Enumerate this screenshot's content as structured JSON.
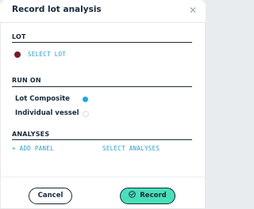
{
  "modal": {
    "title": "Record lot analysis",
    "close_icon": "close-icon"
  },
  "lot": {
    "section_label": "LOT",
    "select_label": "SELECT LOT",
    "dot_color": "#7a1a2c"
  },
  "run_on": {
    "section_label": "RUN ON",
    "options": [
      {
        "label": "Lot Composite",
        "selected": true
      },
      {
        "label": "Individual vessel",
        "selected": false
      }
    ]
  },
  "analyses": {
    "section_label": "ANALYSES",
    "add_panel_label": "+ ADD PANEL",
    "select_analyses_label": "SELECT ANALYSES"
  },
  "footer": {
    "cancel_label": "Cancel",
    "record_label": "Record",
    "record_color": "#49e0b8"
  }
}
